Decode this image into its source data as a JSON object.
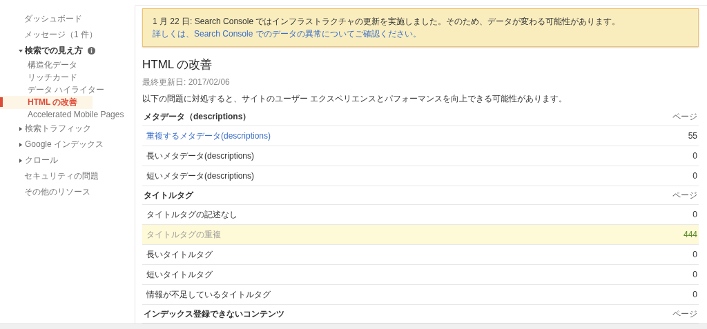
{
  "sidebar": {
    "items": [
      {
        "label": "ダッシュボード",
        "kind": "item"
      },
      {
        "label": "メッセージ（1 件）",
        "kind": "item"
      },
      {
        "label": "検索での見え方",
        "kind": "group",
        "expanded": true,
        "info": true,
        "children": [
          {
            "label": "構造化データ",
            "selected": false
          },
          {
            "label": "リッチカード",
            "selected": false
          },
          {
            "label": "データ ハイライター",
            "selected": false
          },
          {
            "label": "HTML の改善",
            "selected": true
          },
          {
            "label": "Accelerated Mobile Pages",
            "selected": false
          }
        ]
      },
      {
        "label": "検索トラフィック",
        "kind": "group",
        "expanded": false
      },
      {
        "label": "Google インデックス",
        "kind": "group",
        "expanded": false
      },
      {
        "label": "クロール",
        "kind": "group",
        "expanded": false
      },
      {
        "label": "セキュリティの問題",
        "kind": "item"
      },
      {
        "label": "その他のリソース",
        "kind": "item"
      }
    ]
  },
  "notice": {
    "text": "1 月 22 日: Search Console ではインフラストラクチャの更新を実施しました。そのため、データが変わる可能性があります。",
    "link": "詳しくは、Search Console でのデータの異常についてご確認ください。"
  },
  "page": {
    "title": "HTML の改善",
    "updated": "最終更新日: 2017/02/06",
    "description": "以下の問題に対処すると、サイトのユーザー エクスペリエンスとパフォーマンスを向上できる可能性があります。"
  },
  "sections": [
    {
      "heading": "メタデータ（descriptions）",
      "count_heading": "ページ",
      "rows": [
        {
          "label": "重複するメタデータ(descriptions)",
          "count": "55",
          "link": true,
          "highlighted": false
        },
        {
          "label": "長いメタデータ(descriptions)",
          "count": "0",
          "link": false,
          "highlighted": false
        },
        {
          "label": "短いメタデータ(descriptions)",
          "count": "0",
          "link": false,
          "highlighted": false
        }
      ]
    },
    {
      "heading": "タイトルタグ",
      "count_heading": "ページ",
      "rows": [
        {
          "label": "タイトルタグの記述なし",
          "count": "0",
          "link": false,
          "highlighted": false
        },
        {
          "label": "タイトルタグの重複",
          "count": "444",
          "link": false,
          "highlighted": true
        },
        {
          "label": "長いタイトルタグ",
          "count": "0",
          "link": false,
          "highlighted": false
        },
        {
          "label": "短いタイトルタグ",
          "count": "0",
          "link": false,
          "highlighted": false
        },
        {
          "label": "情報が不足しているタイトルタグ",
          "count": "0",
          "link": false,
          "highlighted": false
        }
      ]
    },
    {
      "heading": "インデックス登録できないコンテンツ",
      "count_heading": "ページ"
    }
  ]
}
